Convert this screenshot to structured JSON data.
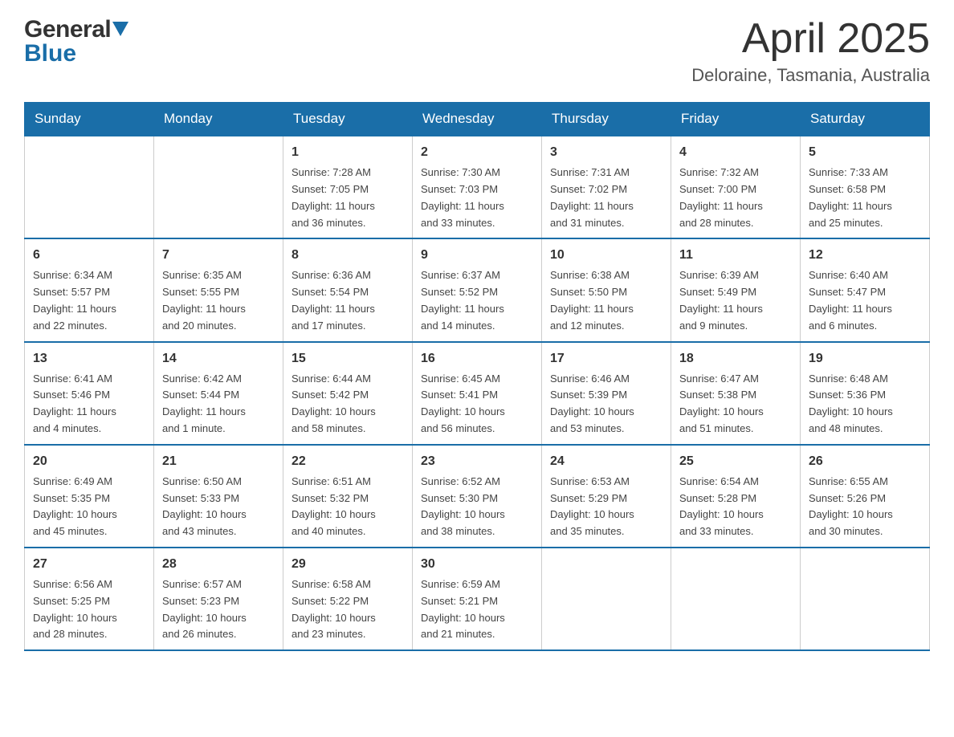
{
  "header": {
    "logo_general": "General",
    "logo_blue": "Blue",
    "month_title": "April 2025",
    "location": "Deloraine, Tasmania, Australia"
  },
  "days_of_week": [
    "Sunday",
    "Monday",
    "Tuesday",
    "Wednesday",
    "Thursday",
    "Friday",
    "Saturday"
  ],
  "weeks": [
    [
      {
        "day": "",
        "info": ""
      },
      {
        "day": "",
        "info": ""
      },
      {
        "day": "1",
        "info": "Sunrise: 7:28 AM\nSunset: 7:05 PM\nDaylight: 11 hours\nand 36 minutes."
      },
      {
        "day": "2",
        "info": "Sunrise: 7:30 AM\nSunset: 7:03 PM\nDaylight: 11 hours\nand 33 minutes."
      },
      {
        "day": "3",
        "info": "Sunrise: 7:31 AM\nSunset: 7:02 PM\nDaylight: 11 hours\nand 31 minutes."
      },
      {
        "day": "4",
        "info": "Sunrise: 7:32 AM\nSunset: 7:00 PM\nDaylight: 11 hours\nand 28 minutes."
      },
      {
        "day": "5",
        "info": "Sunrise: 7:33 AM\nSunset: 6:58 PM\nDaylight: 11 hours\nand 25 minutes."
      }
    ],
    [
      {
        "day": "6",
        "info": "Sunrise: 6:34 AM\nSunset: 5:57 PM\nDaylight: 11 hours\nand 22 minutes."
      },
      {
        "day": "7",
        "info": "Sunrise: 6:35 AM\nSunset: 5:55 PM\nDaylight: 11 hours\nand 20 minutes."
      },
      {
        "day": "8",
        "info": "Sunrise: 6:36 AM\nSunset: 5:54 PM\nDaylight: 11 hours\nand 17 minutes."
      },
      {
        "day": "9",
        "info": "Sunrise: 6:37 AM\nSunset: 5:52 PM\nDaylight: 11 hours\nand 14 minutes."
      },
      {
        "day": "10",
        "info": "Sunrise: 6:38 AM\nSunset: 5:50 PM\nDaylight: 11 hours\nand 12 minutes."
      },
      {
        "day": "11",
        "info": "Sunrise: 6:39 AM\nSunset: 5:49 PM\nDaylight: 11 hours\nand 9 minutes."
      },
      {
        "day": "12",
        "info": "Sunrise: 6:40 AM\nSunset: 5:47 PM\nDaylight: 11 hours\nand 6 minutes."
      }
    ],
    [
      {
        "day": "13",
        "info": "Sunrise: 6:41 AM\nSunset: 5:46 PM\nDaylight: 11 hours\nand 4 minutes."
      },
      {
        "day": "14",
        "info": "Sunrise: 6:42 AM\nSunset: 5:44 PM\nDaylight: 11 hours\nand 1 minute."
      },
      {
        "day": "15",
        "info": "Sunrise: 6:44 AM\nSunset: 5:42 PM\nDaylight: 10 hours\nand 58 minutes."
      },
      {
        "day": "16",
        "info": "Sunrise: 6:45 AM\nSunset: 5:41 PM\nDaylight: 10 hours\nand 56 minutes."
      },
      {
        "day": "17",
        "info": "Sunrise: 6:46 AM\nSunset: 5:39 PM\nDaylight: 10 hours\nand 53 minutes."
      },
      {
        "day": "18",
        "info": "Sunrise: 6:47 AM\nSunset: 5:38 PM\nDaylight: 10 hours\nand 51 minutes."
      },
      {
        "day": "19",
        "info": "Sunrise: 6:48 AM\nSunset: 5:36 PM\nDaylight: 10 hours\nand 48 minutes."
      }
    ],
    [
      {
        "day": "20",
        "info": "Sunrise: 6:49 AM\nSunset: 5:35 PM\nDaylight: 10 hours\nand 45 minutes."
      },
      {
        "day": "21",
        "info": "Sunrise: 6:50 AM\nSunset: 5:33 PM\nDaylight: 10 hours\nand 43 minutes."
      },
      {
        "day": "22",
        "info": "Sunrise: 6:51 AM\nSunset: 5:32 PM\nDaylight: 10 hours\nand 40 minutes."
      },
      {
        "day": "23",
        "info": "Sunrise: 6:52 AM\nSunset: 5:30 PM\nDaylight: 10 hours\nand 38 minutes."
      },
      {
        "day": "24",
        "info": "Sunrise: 6:53 AM\nSunset: 5:29 PM\nDaylight: 10 hours\nand 35 minutes."
      },
      {
        "day": "25",
        "info": "Sunrise: 6:54 AM\nSunset: 5:28 PM\nDaylight: 10 hours\nand 33 minutes."
      },
      {
        "day": "26",
        "info": "Sunrise: 6:55 AM\nSunset: 5:26 PM\nDaylight: 10 hours\nand 30 minutes."
      }
    ],
    [
      {
        "day": "27",
        "info": "Sunrise: 6:56 AM\nSunset: 5:25 PM\nDaylight: 10 hours\nand 28 minutes."
      },
      {
        "day": "28",
        "info": "Sunrise: 6:57 AM\nSunset: 5:23 PM\nDaylight: 10 hours\nand 26 minutes."
      },
      {
        "day": "29",
        "info": "Sunrise: 6:58 AM\nSunset: 5:22 PM\nDaylight: 10 hours\nand 23 minutes."
      },
      {
        "day": "30",
        "info": "Sunrise: 6:59 AM\nSunset: 5:21 PM\nDaylight: 10 hours\nand 21 minutes."
      },
      {
        "day": "",
        "info": ""
      },
      {
        "day": "",
        "info": ""
      },
      {
        "day": "",
        "info": ""
      }
    ]
  ]
}
